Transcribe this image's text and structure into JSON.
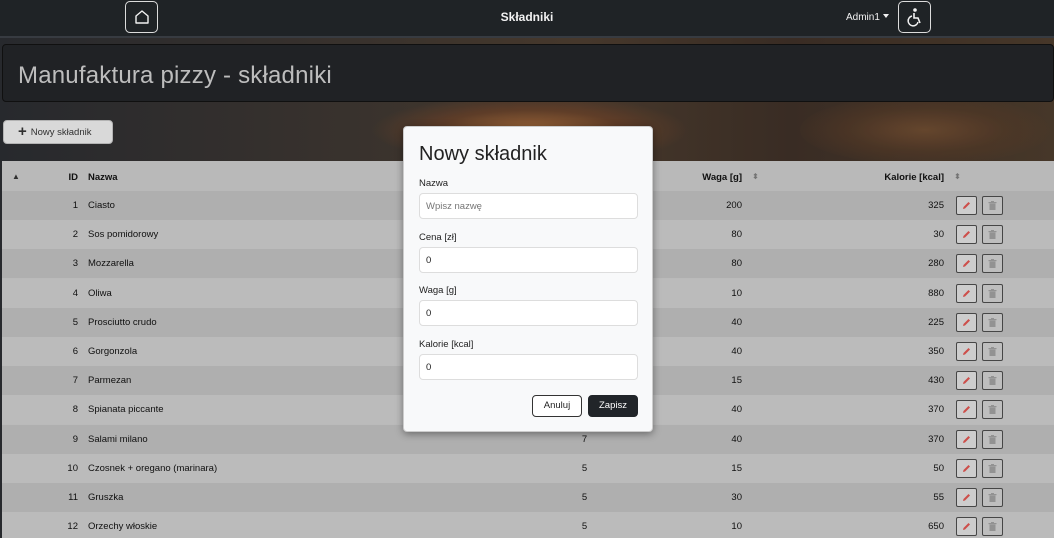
{
  "navbar": {
    "title": "Składniki",
    "user": "Admin1",
    "home_icon": "home-icon",
    "accessibility_icon": "wheelchair-icon"
  },
  "banner": {
    "title": "Manufaktura pizzy - składniki"
  },
  "toolbar": {
    "new_label": "Nowy składnik",
    "new_icon": "plus-icon"
  },
  "table": {
    "headers": {
      "id": "ID",
      "name": "Nazwa",
      "weight": "Waga [g]",
      "kcal": "Kalorie [kcal]"
    },
    "rows": [
      {
        "id": "1",
        "name": "Ciasto",
        "price": "",
        "weight": "200",
        "kcal": "325"
      },
      {
        "id": "2",
        "name": "Sos pomidorowy",
        "price": "",
        "weight": "80",
        "kcal": "30"
      },
      {
        "id": "3",
        "name": "Mozzarella",
        "price": "",
        "weight": "80",
        "kcal": "280"
      },
      {
        "id": "4",
        "name": "Oliwa",
        "price": "",
        "weight": "10",
        "kcal": "880"
      },
      {
        "id": "5",
        "name": "Prosciutto crudo",
        "price": "",
        "weight": "40",
        "kcal": "225"
      },
      {
        "id": "6",
        "name": "Gorgonzola",
        "price": "",
        "weight": "40",
        "kcal": "350"
      },
      {
        "id": "7",
        "name": "Parmezan",
        "price": "",
        "weight": "15",
        "kcal": "430"
      },
      {
        "id": "8",
        "name": "Spianata piccante",
        "price": "",
        "weight": "40",
        "kcal": "370"
      },
      {
        "id": "9",
        "name": "Salami milano",
        "price": "7",
        "weight": "40",
        "kcal": "370"
      },
      {
        "id": "10",
        "name": "Czosnek + oregano (marinara)",
        "price": "5",
        "weight": "15",
        "kcal": "50"
      },
      {
        "id": "11",
        "name": "Gruszka",
        "price": "5",
        "weight": "30",
        "kcal": "55"
      },
      {
        "id": "12",
        "name": "Orzechy włoskie",
        "price": "5",
        "weight": "10",
        "kcal": "650"
      }
    ]
  },
  "modal": {
    "title": "Nowy składnik",
    "fields": [
      {
        "label": "Nazwa",
        "value": "",
        "placeholder": "Wpisz nazwę"
      },
      {
        "label": "Cena [zł]",
        "value": "0",
        "placeholder": ""
      },
      {
        "label": "Waga [g]",
        "value": "0",
        "placeholder": ""
      },
      {
        "label": "Kalorie [kcal]",
        "value": "0",
        "placeholder": ""
      }
    ],
    "cancel_label": "Anuluj",
    "save_label": "Zapisz"
  },
  "colors": {
    "navbar": "#212529",
    "edit_icon": "#d9534f",
    "save_button": "#212529"
  }
}
